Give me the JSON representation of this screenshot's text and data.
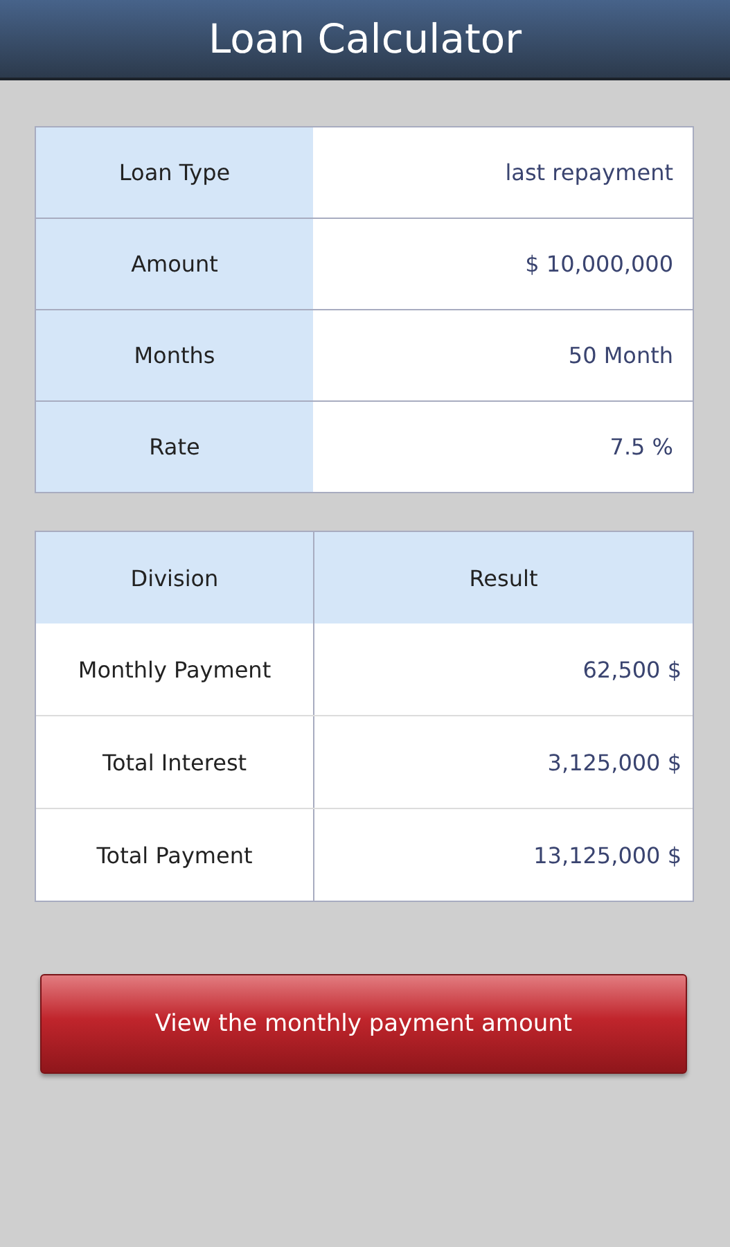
{
  "window": {
    "title": "Loan Calculator"
  },
  "inputs": [
    {
      "label": "Loan Type",
      "value": "last repayment"
    },
    {
      "label": "Amount",
      "value": "$ 10,000,000"
    },
    {
      "label": "Months",
      "value": "50 Month"
    },
    {
      "label": "Rate",
      "value": "7.5 %"
    }
  ],
  "results": {
    "columns": [
      "Division",
      "Result"
    ],
    "rows": [
      {
        "label": "Monthly Payment",
        "value": "62,500 $"
      },
      {
        "label": "Total Interest",
        "value": "3,125,000 $"
      },
      {
        "label": "Total Payment",
        "value": "13,125,000 $"
      }
    ]
  },
  "button": "View the monthly payment amount"
}
